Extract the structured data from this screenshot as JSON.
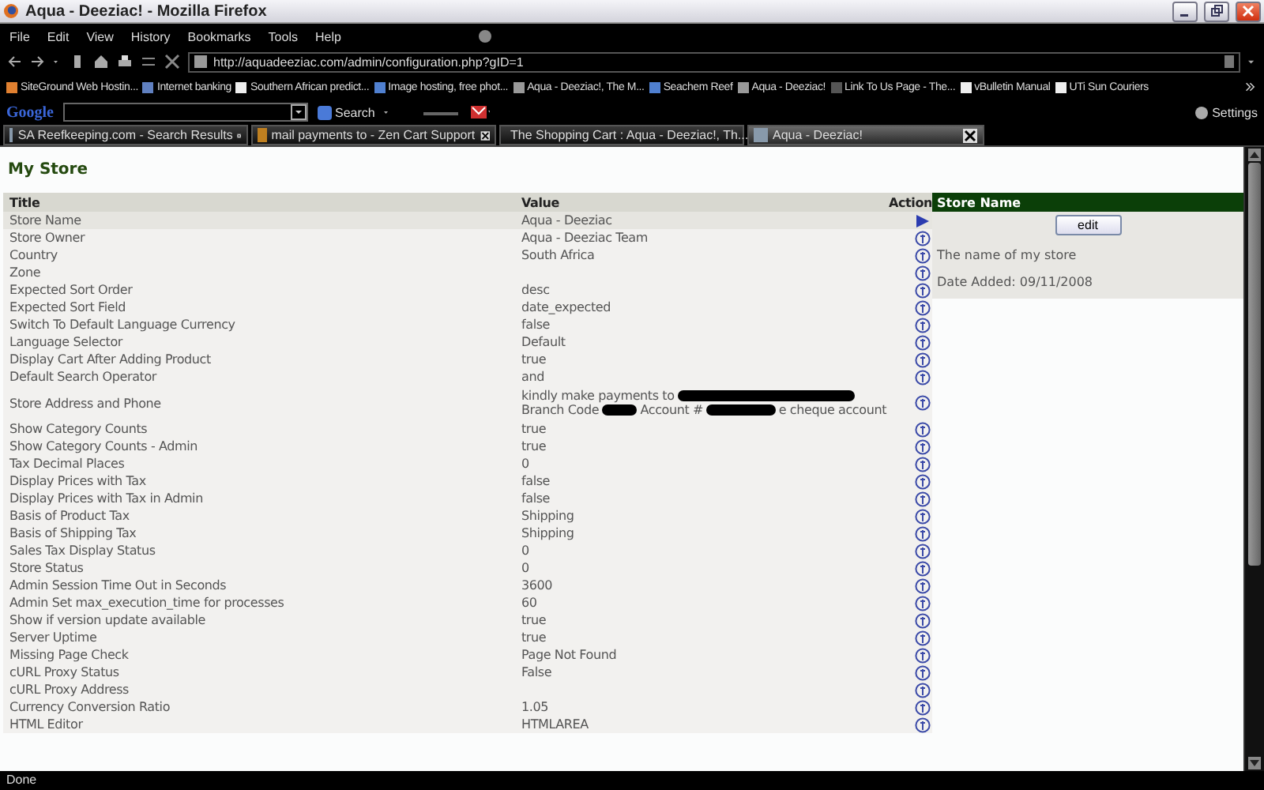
{
  "window": {
    "title": "Aqua - Deeziac! - Mozilla Firefox"
  },
  "menu": [
    "File",
    "Edit",
    "View",
    "History",
    "Bookmarks",
    "Tools",
    "Help"
  ],
  "address_bar": {
    "url": "http://aquadeeziac.com/admin/configuration.php?gID=1"
  },
  "bookmarks": [
    "SiteGround Web Hostin...",
    "Internet banking",
    "Southern African predict...",
    "Image hosting, free phot...",
    "Aqua - Deeziac!, The M...",
    "Seachem Reef",
    "Aqua - Deeziac!",
    "Link To Us Page - The...",
    "vBulletin Manual",
    "UTi Sun Couriers"
  ],
  "google_toolbar": {
    "logo": "Google",
    "search_button": "Search",
    "settings": "Settings"
  },
  "tabs": [
    {
      "label": "SA Reefkeeping.com - Search Results",
      "selected": false
    },
    {
      "label": "mail payments to - Zen Cart Support",
      "selected": false
    },
    {
      "label": "The Shopping Cart : Aqua - Deeziac!, Th...",
      "selected": false
    },
    {
      "label": "Aqua - Deeziac!",
      "selected": true
    }
  ],
  "page": {
    "heading": "My Store",
    "table": {
      "columns": [
        "Title",
        "Value",
        "Action"
      ],
      "rows": [
        {
          "title": "Store Name",
          "value": "Aqua - Deeziac",
          "selected": true
        },
        {
          "title": "Store Owner",
          "value": "Aqua - Deeziac Team",
          "selected": false
        },
        {
          "title": "Country",
          "value": "South Africa",
          "selected": false
        },
        {
          "title": "Zone",
          "selected": false
        },
        {
          "title": "Expected Sort Order",
          "value": "desc",
          "selected": false
        },
        {
          "title": "Expected Sort Field",
          "value": "date_expected",
          "selected": false
        },
        {
          "title": "Switch To Default Language Currency",
          "value": "false",
          "selected": false
        },
        {
          "title": "Language Selector",
          "value": "Default",
          "selected": false
        },
        {
          "title": "Display Cart After Adding Product",
          "value": "true",
          "selected": false
        },
        {
          "title": "Default Search Operator",
          "value": "and",
          "selected": false
        },
        {
          "title": "Store Address and Phone",
          "value_lines": [
            [
              {
                "kind": "text",
                "text": "kindly make payments to"
              },
              {
                "kind": "redacted"
              }
            ],
            [
              {
                "kind": "text",
                "text": "Branch Code"
              },
              {
                "kind": "redacted"
              },
              {
                "kind": "text",
                "text": "Account #"
              },
              {
                "kind": "redacted"
              },
              {
                "kind": "text",
                "text": "e cheque account"
              }
            ]
          ],
          "selected": false
        },
        {
          "title": "Show Category Counts",
          "value": "true",
          "selected": false
        },
        {
          "title": "Show Category Counts - Admin",
          "value": "true",
          "selected": false
        },
        {
          "title": "Tax Decimal Places",
          "value": "0",
          "selected": false
        },
        {
          "title": "Display Prices with Tax",
          "value": "false",
          "selected": false
        },
        {
          "title": "Display Prices with Tax in Admin",
          "value": "false",
          "selected": false
        },
        {
          "title": "Basis of Product Tax",
          "value": "Shipping",
          "selected": false
        },
        {
          "title": "Basis of Shipping Tax",
          "value": "Shipping",
          "selected": false
        },
        {
          "title": "Sales Tax Display Status",
          "value": "0",
          "selected": false
        },
        {
          "title": "Store Status",
          "value": "0",
          "selected": false
        },
        {
          "title": "Admin Session Time Out in Seconds",
          "value": "3600",
          "selected": false
        },
        {
          "title": "Admin Set max_execution_time for processes",
          "value": "60",
          "selected": false
        },
        {
          "title": "Show if version update available",
          "value": "true",
          "selected": false
        },
        {
          "title": "Server Uptime",
          "value": "true",
          "selected": false
        },
        {
          "title": "Missing Page Check",
          "value": "Page Not Found",
          "selected": false
        },
        {
          "title": "cURL Proxy Status",
          "value": "False",
          "selected": false
        },
        {
          "title": "cURL Proxy Address",
          "selected": false
        },
        {
          "title": "Currency Conversion Ratio",
          "value": "1.05",
          "selected": false
        },
        {
          "title": "HTML Editor",
          "value": "HTMLAREA",
          "selected": false
        }
      ]
    },
    "info_panel": {
      "heading": "Store Name",
      "button": "edit",
      "description": "The name of my store",
      "date_added": "Date Added: 09/11/2008"
    }
  },
  "status_bar": "Done"
}
